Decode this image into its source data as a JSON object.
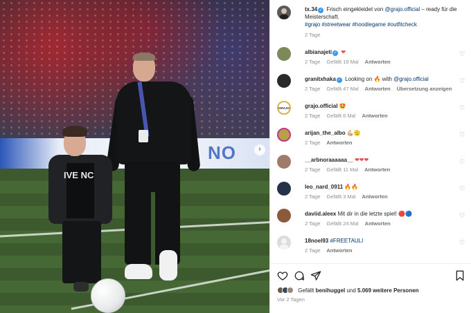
{
  "post": {
    "author": "tx.34",
    "caption_before": "Frisch eingekleidet von ",
    "caption_mention": "@grajo.official",
    "caption_after": " – ready für die Meisterschaft.",
    "hashtags": "#grajo #streetwear #hoodiegame #outfitcheck",
    "time": "2 Tage"
  },
  "photo": {
    "board_text": "NO",
    "boy_print": "IVE NC",
    "next_icon": "chevron-right-icon"
  },
  "comments": [
    {
      "user": "albianajeti",
      "verified": true,
      "text": "",
      "emoji": "❤",
      "time": "2 Tage",
      "likes": "Gefällt 19 Mal",
      "reply": "Antworten",
      "avatar_color": "#7c8a5a"
    },
    {
      "user": "granitxhaka",
      "verified": true,
      "text_before": "Looking on ",
      "text_emoji": "🔥",
      "text_mid": " with ",
      "mention": "@grajo.official",
      "time": "2 Tage",
      "likes": "Gefällt 47 Mal",
      "reply": "Antworten",
      "translation": "Übersetzung anzeigen",
      "avatar_color": "#2a2a2a"
    },
    {
      "user": "grajo.official",
      "verified": false,
      "text": "🤩",
      "time": "2 Tage",
      "likes": "Gefällt 6 Mal",
      "reply": "Antworten",
      "avatar_label": "GRAJO",
      "avatar_color": "#ffffff"
    },
    {
      "user": "arijan_the_albo",
      "verified": false,
      "text": "💪🏼🫡",
      "time": "2 Tage",
      "reply": "Antworten",
      "avatar_color": "#b8a04a"
    },
    {
      "user": "__arbnoraaaaaa__",
      "verified": false,
      "text": "❤❤❤",
      "time": "2 Tage",
      "likes": "Gefällt 11 Mal",
      "reply": "Antworten",
      "avatar_color": "#a07b6a"
    },
    {
      "user": "leo_nard_0911",
      "verified": false,
      "text": "🔥🔥",
      "time": "2 Tage",
      "likes": "Gefällt 3 Mal",
      "reply": "Antworten",
      "avatar_color": "#25324a"
    },
    {
      "user": "daviid.aleex",
      "verified": false,
      "text": "Mit dir in die letzte spiel! 🔴🔵",
      "time": "2 Tage",
      "likes": "Gefällt 24 Mal",
      "reply": "Antworten",
      "avatar_color": "#8a5a3a"
    },
    {
      "user": "18noel93",
      "verified": false,
      "tag": "#FREETAULI",
      "time": "2 Tage",
      "reply": "Antworten",
      "avatar_color": "#dcdcdc"
    }
  ],
  "footer": {
    "likes_prefix": "Gefällt ",
    "likes_user": "benihuggel",
    "likes_mid": " und ",
    "likes_count": "5.069 weitere Personen",
    "date": "Vor 2 Tagen"
  },
  "colors": {
    "verified": "#3897f0",
    "link": "#00376b",
    "muted": "#8e8e8e",
    "heart_red": "#ed4956"
  }
}
